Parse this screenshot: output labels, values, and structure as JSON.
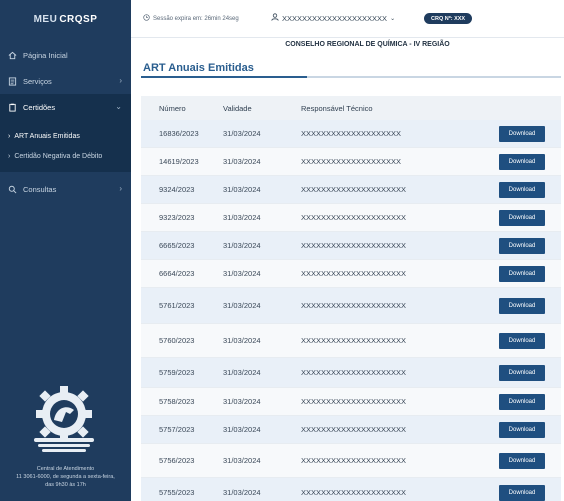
{
  "brand": {
    "part1": "MEU",
    "part2": "CRQSP"
  },
  "sidebar": {
    "items": [
      {
        "label": "Página Inicial"
      },
      {
        "label": "Serviços",
        "chevron": "›"
      },
      {
        "label": "Certidões",
        "chevron": "⌄"
      },
      {
        "label": "Consultas",
        "chevron": "›"
      }
    ],
    "submenu": [
      {
        "label": "ART Anuais Emitidas"
      },
      {
        "label": "Certidão Negativa de Débito"
      }
    ],
    "support": {
      "title": "Central de Atendimento",
      "line1": "11 3061-6000, de segunda a sexta-feira,",
      "line2": "das 9h30 às 17h"
    }
  },
  "topbar": {
    "session": "Sessão expira em: 26min 24seg",
    "user": "XXXXXXXXXXXXXXXXXXXXX",
    "crq_badge": "CRQ Nº: XXX"
  },
  "main": {
    "council": "CONSELHO REGIONAL DE QUÍMICA - IV REGIÃO",
    "title": "ART Anuais Emitidas",
    "columns": [
      "Número",
      "Validade",
      "Responsável Técnico",
      ""
    ],
    "download_label": "Download",
    "rows": [
      {
        "numero": "16836/2023",
        "validade": "31/03/2024",
        "responsavel": "XXXXXXXXXXXXXXXXXXXX"
      },
      {
        "numero": "14619/2023",
        "validade": "31/03/2024",
        "responsavel": "XXXXXXXXXXXXXXXXXXXX"
      },
      {
        "numero": "9324/2023",
        "validade": "31/03/2024",
        "responsavel": "XXXXXXXXXXXXXXXXXXXXX"
      },
      {
        "numero": "9323/2023",
        "validade": "31/03/2024",
        "responsavel": "XXXXXXXXXXXXXXXXXXXXX"
      },
      {
        "numero": "6665/2023",
        "validade": "31/03/2024",
        "responsavel": "XXXXXXXXXXXXXXXXXXXXX"
      },
      {
        "numero": "6664/2023",
        "validade": "31/03/2024",
        "responsavel": "XXXXXXXXXXXXXXXXXXXXX"
      },
      {
        "numero": "5761/2023",
        "validade": "31/03/2024",
        "responsavel": "XXXXXXXXXXXXXXXXXXXXX"
      },
      {
        "numero": "5760/2023",
        "validade": "31/03/2024",
        "responsavel": "XXXXXXXXXXXXXXXXXXXXX"
      },
      {
        "numero": "5759/2023",
        "validade": "31/03/2024",
        "responsavel": "XXXXXXXXXXXXXXXXXXXXX"
      },
      {
        "numero": "5758/2023",
        "validade": "31/03/2024",
        "responsavel": "XXXXXXXXXXXXXXXXXXXXX"
      },
      {
        "numero": "5757/2023",
        "validade": "31/03/2024",
        "responsavel": "XXXXXXXXXXXXXXXXXXXXX"
      },
      {
        "numero": "5756/2023",
        "validade": "31/03/2024",
        "responsavel": "XXXXXXXXXXXXXXXXXXXXX"
      },
      {
        "numero": "5755/2023",
        "validade": "31/03/2024",
        "responsavel": "XXXXXXXXXXXXXXXXXXXXX"
      }
    ]
  },
  "icons": {
    "home": "home-icon",
    "services": "document-list-icon",
    "certificates": "clipboard-icon",
    "search": "search-icon",
    "clock": "clock-icon",
    "user": "user-icon",
    "gear_logo": "gear-logo"
  },
  "colors": {
    "sidebar": "#1f3c5e",
    "sidebar_active": "#15304d",
    "accent": "#2a5e8f",
    "button": "#1f4f80",
    "row_highlight": "#e9f0f8"
  }
}
